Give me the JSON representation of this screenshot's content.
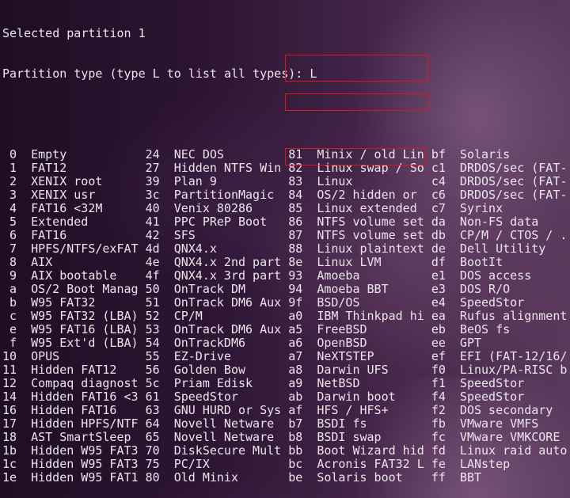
{
  "terminal": {
    "lines": [
      "Selected partition 1",
      "Partition type (type L to list all types): L"
    ],
    "columns": [
      [
        [
          "0",
          "Empty"
        ],
        [
          "1",
          "FAT12"
        ],
        [
          "2",
          "XENIX root"
        ],
        [
          "3",
          "XENIX usr"
        ],
        [
          "4",
          "FAT16 <32M"
        ],
        [
          "5",
          "Extended"
        ],
        [
          "6",
          "FAT16"
        ],
        [
          "7",
          "HPFS/NTFS/exFAT"
        ],
        [
          "8",
          "AIX"
        ],
        [
          "9",
          "AIX bootable"
        ],
        [
          "a",
          "OS/2 Boot Manag"
        ],
        [
          "b",
          "W95 FAT32"
        ],
        [
          "c",
          "W95 FAT32 (LBA)"
        ],
        [
          "e",
          "W95 FAT16 (LBA)"
        ],
        [
          "f",
          "W95 Ext'd (LBA)"
        ],
        [
          "10",
          "OPUS"
        ],
        [
          "11",
          "Hidden FAT12"
        ],
        [
          "12",
          "Compaq diagnost"
        ],
        [
          "14",
          "Hidden FAT16 <3"
        ],
        [
          "16",
          "Hidden FAT16"
        ],
        [
          "17",
          "Hidden HPFS/NTF"
        ],
        [
          "18",
          "AST SmartSleep"
        ],
        [
          "1b",
          "Hidden W95 FAT3"
        ],
        [
          "1c",
          "Hidden W95 FAT3"
        ],
        [
          "1e",
          "Hidden W95 FAT1"
        ]
      ],
      [
        [
          "24",
          "NEC DOS"
        ],
        [
          "27",
          "Hidden NTFS Win"
        ],
        [
          "39",
          "Plan 9"
        ],
        [
          "3c",
          "PartitionMagic"
        ],
        [
          "40",
          "Venix 80286"
        ],
        [
          "41",
          "PPC PReP Boot"
        ],
        [
          "42",
          "SFS"
        ],
        [
          "4d",
          "QNX4.x"
        ],
        [
          "4e",
          "QNX4.x 2nd part"
        ],
        [
          "4f",
          "QNX4.x 3rd part"
        ],
        [
          "50",
          "OnTrack DM"
        ],
        [
          "51",
          "OnTrack DM6 Aux"
        ],
        [
          "52",
          "CP/M"
        ],
        [
          "53",
          "OnTrack DM6 Aux"
        ],
        [
          "54",
          "OnTrackDM6"
        ],
        [
          "55",
          "EZ-Drive"
        ],
        [
          "56",
          "Golden Bow"
        ],
        [
          "5c",
          "Priam Edisk"
        ],
        [
          "61",
          "SpeedStor"
        ],
        [
          "63",
          "GNU HURD or Sys"
        ],
        [
          "64",
          "Novell Netware"
        ],
        [
          "65",
          "Novell Netware"
        ],
        [
          "70",
          "DiskSecure Mult"
        ],
        [
          "75",
          "PC/IX"
        ],
        [
          "80",
          "Old Minix"
        ]
      ],
      [
        [
          "81",
          "Minix / old Lin"
        ],
        [
          "82",
          "Linux swap / So"
        ],
        [
          "83",
          "Linux"
        ],
        [
          "84",
          "OS/2 hidden or"
        ],
        [
          "85",
          "Linux extended"
        ],
        [
          "86",
          "NTFS volume set"
        ],
        [
          "87",
          "NTFS volume set"
        ],
        [
          "88",
          "Linux plaintext"
        ],
        [
          "8e",
          "Linux LVM"
        ],
        [
          "93",
          "Amoeba"
        ],
        [
          "94",
          "Amoeba BBT"
        ],
        [
          "9f",
          "BSD/OS"
        ],
        [
          "a0",
          "IBM Thinkpad hi"
        ],
        [
          "a5",
          "FreeBSD"
        ],
        [
          "a6",
          "OpenBSD"
        ],
        [
          "a7",
          "NeXTSTEP"
        ],
        [
          "a8",
          "Darwin UFS"
        ],
        [
          "a9",
          "NetBSD"
        ],
        [
          "ab",
          "Darwin boot"
        ],
        [
          "af",
          "HFS / HFS+"
        ],
        [
          "b7",
          "BSDI fs"
        ],
        [
          "b8",
          "BSDI swap"
        ],
        [
          "bb",
          "Boot Wizard hid"
        ],
        [
          "bc",
          "Acronis FAT32 L"
        ],
        [
          "be",
          "Solaris boot"
        ]
      ],
      [
        [
          "bf",
          "Solaris"
        ],
        [
          "c1",
          "DRDOS/sec (FAT-"
        ],
        [
          "c4",
          "DRDOS/sec (FAT-"
        ],
        [
          "c6",
          "DRDOS/sec (FAT-"
        ],
        [
          "c7",
          "Syrinx"
        ],
        [
          "da",
          "Non-FS data"
        ],
        [
          "db",
          "CP/M / CTOS / ."
        ],
        [
          "de",
          "Dell Utility"
        ],
        [
          "df",
          "BootIt"
        ],
        [
          "e1",
          "DOS access"
        ],
        [
          "e3",
          "DOS R/O"
        ],
        [
          "e4",
          "SpeedStor"
        ],
        [
          "ea",
          "Rufus alignment"
        ],
        [
          "eb",
          "BeOS fs"
        ],
        [
          "ee",
          "GPT"
        ],
        [
          "ef",
          "EFI (FAT-12/16/"
        ],
        [
          "f0",
          "Linux/PA-RISC b"
        ],
        [
          "f1",
          "SpeedStor"
        ],
        [
          "f4",
          "SpeedStor"
        ],
        [
          "f2",
          "DOS secondary"
        ],
        [
          "fb",
          "VMware VMFS"
        ],
        [
          "fc",
          "VMware VMKCORE"
        ],
        [
          "fd",
          "Linux raid auto"
        ],
        [
          "fe",
          "LANstep"
        ],
        [
          "ff",
          "BBT"
        ]
      ]
    ]
  },
  "highlight_color": "#e0141e"
}
